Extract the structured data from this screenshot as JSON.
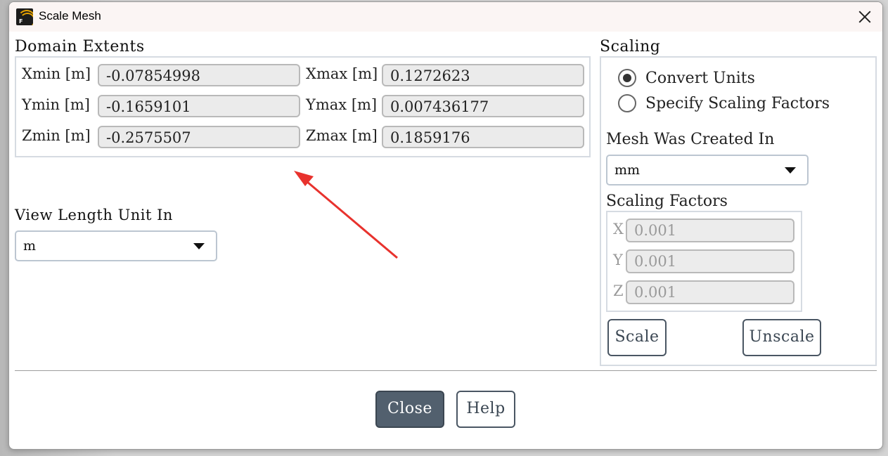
{
  "window": {
    "title": "Scale Mesh",
    "app_icon": "fluent-icon",
    "close_icon": "close-icon"
  },
  "domain_extents": {
    "title": "Domain Extents",
    "rows": [
      {
        "min_label": "Xmin [m]",
        "min_value": "-0.07854998",
        "max_label": "Xmax [m]",
        "max_value": "0.1272623"
      },
      {
        "min_label": "Ymin [m]",
        "min_value": "-0.1659101",
        "max_label": "Ymax [m]",
        "max_value": "0.007436177"
      },
      {
        "min_label": "Zmin [m]",
        "min_value": "-0.2575507",
        "max_label": "Zmax [m]",
        "max_value": "0.1859176"
      }
    ]
  },
  "view_length": {
    "label": "View Length Unit In",
    "value": "m"
  },
  "scaling": {
    "title": "Scaling",
    "options": [
      {
        "label": "Convert Units",
        "checked": true
      },
      {
        "label": "Specify Scaling Factors",
        "checked": false
      }
    ],
    "mesh_created_label": "Mesh Was Created In",
    "mesh_created_value": "mm",
    "factors_title": "Scaling Factors",
    "factors": [
      {
        "axis": "X",
        "value": "0.001"
      },
      {
        "axis": "Y",
        "value": "0.001"
      },
      {
        "axis": "Z",
        "value": "0.001"
      }
    ],
    "scale_label": "Scale",
    "unscale_label": "Unscale"
  },
  "footer": {
    "close_label": "Close",
    "help_label": "Help"
  },
  "colors": {
    "annotation_arrow": "#e8322d",
    "primary_button": "#52606e"
  }
}
